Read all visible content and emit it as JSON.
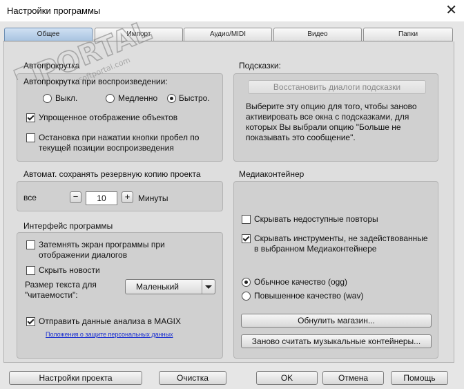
{
  "window": {
    "title": "Настройки программы",
    "close_glyph": "✕"
  },
  "tabs": [
    {
      "label": "Общее",
      "active": true
    },
    {
      "label": "Импорт",
      "active": false
    },
    {
      "label": "Аудио/MIDI",
      "active": false
    },
    {
      "label": "Видео",
      "active": false
    },
    {
      "label": "Папки",
      "active": false
    }
  ],
  "scroll": {
    "title": "Автопрокрутка",
    "subtitle": "Автопрокрутка при воспроизведении:",
    "options": [
      {
        "label": "Выкл.",
        "selected": false
      },
      {
        "label": "Медленно",
        "selected": false
      },
      {
        "label": "Быстро.",
        "selected": true
      }
    ],
    "simplified_display": {
      "label": "Упрощенное отображение объектов",
      "checked": true
    },
    "stop_on_space": {
      "label_line1": "Остановка при нажатии кнопки пробел по",
      "label_line2": "текущей позиции воспроизведения",
      "checked": false
    }
  },
  "hints": {
    "title": "Подсказки:",
    "restore_button": "Восстановить диалоги подсказки",
    "description": [
      "Выберите эту опцию для того, чтобы заново",
      "активировать все окна с подсказками, для",
      "которых Вы выбрали опцию \"Больше не",
      "показывать это сообщение\"."
    ]
  },
  "backup": {
    "title": "Автомат. сохранять резервную копию проекта",
    "prefix": "все",
    "minus": "−",
    "value": "10",
    "plus": "+",
    "unit": "Минуты"
  },
  "media_container": {
    "title": "Медиаконтейнер",
    "hide_unavailable": {
      "label": "Скрывать недоступные повторы",
      "checked": false
    },
    "hide_unused": {
      "label_line1": "Скрывать инструменты, не задействованные",
      "label_line2": "в выбранном Медиаконтейнере",
      "checked": true
    },
    "quality": [
      {
        "label": "Обычное качество (ogg)",
        "selected": true
      },
      {
        "label": "Повышенное качество (wav)",
        "selected": false
      }
    ],
    "reset_store_button": "Обнулить магазин...",
    "recount_button": "Заново считать музыкальные контейнеры..."
  },
  "interface": {
    "title": "Интерфейс программы",
    "dim_screen": {
      "label_line1": "Затемнять экран программы при",
      "label_line2": "отображении диалогов",
      "checked": false
    },
    "hide_news": {
      "label": "Скрыть новости",
      "checked": false
    },
    "text_size_label_line1": "Размер текста для",
    "text_size_label_line2": "\"читаемости\":",
    "text_size_value": "Маленький",
    "send_analytics": {
      "label": "Отправить данные анализа в MAGIX",
      "checked": true
    },
    "privacy_link": "Положения о защите персональных данных"
  },
  "footer": {
    "project_settings": "Настройки проекта",
    "clear": "Очистка",
    "ok": "OK",
    "cancel": "Отмена",
    "help": "Помощь"
  },
  "watermark": {
    "brand": "PORTAL",
    "tm": "TM",
    "domain": "softportal.com"
  }
}
